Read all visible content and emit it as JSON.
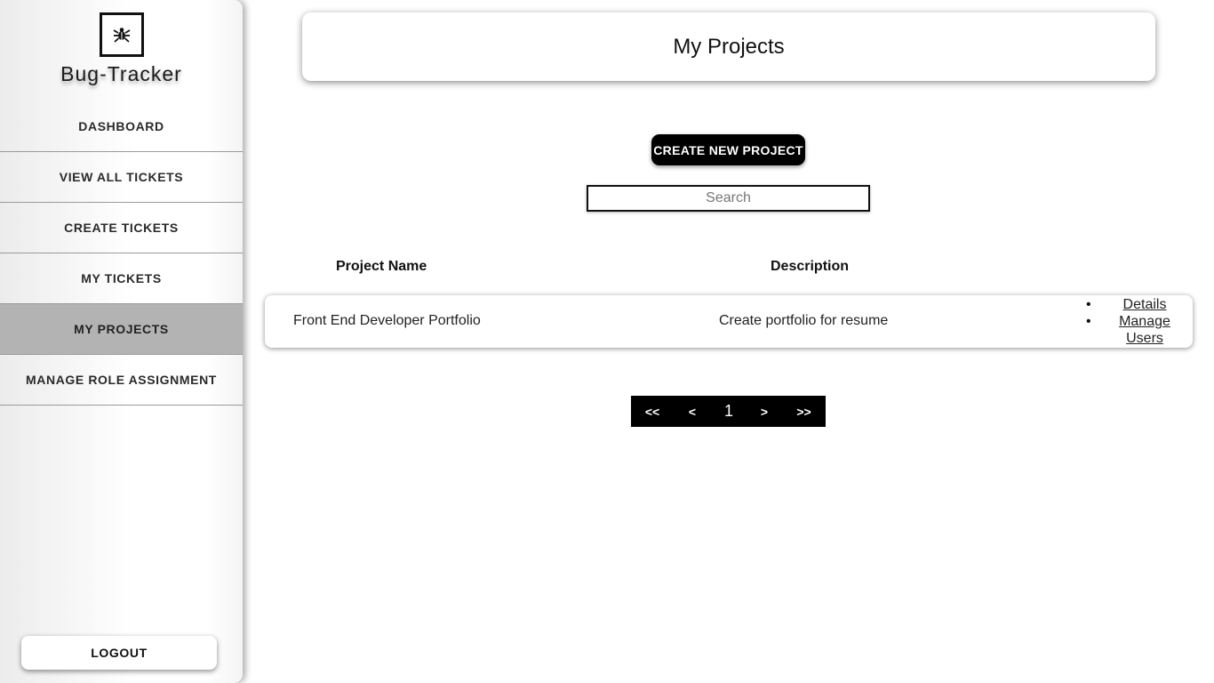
{
  "sidebar": {
    "logo_icon": "bug-icon",
    "brand": "Bug-Tracker",
    "items": [
      {
        "label": "DASHBOARD",
        "active": false
      },
      {
        "label": "VIEW ALL TICKETS",
        "active": false
      },
      {
        "label": "CREATE TICKETS",
        "active": false
      },
      {
        "label": "MY TICKETS",
        "active": false
      },
      {
        "label": "MY PROJECTS",
        "active": true
      },
      {
        "label": "MANAGE ROLE ASSIGNMENT",
        "active": false
      }
    ],
    "logout_label": "LOGOUT"
  },
  "main": {
    "title": "My Projects",
    "create_button": "CREATE NEW PROJECT",
    "search": {
      "placeholder": "Search",
      "value": ""
    },
    "table": {
      "headers": [
        "Project Name",
        "Description"
      ],
      "rows": [
        {
          "name": "Front End Developer Portfolio",
          "description": "Create portfolio for resume",
          "actions": [
            "Details",
            "Manage Users"
          ]
        }
      ]
    },
    "pagination": {
      "first": "<<",
      "prev": "<",
      "current": "1",
      "next": ">",
      "last": ">>"
    }
  },
  "colors": {
    "active_nav": "#b3b3b3",
    "button_bg": "#000000",
    "button_text": "#ffffff"
  }
}
